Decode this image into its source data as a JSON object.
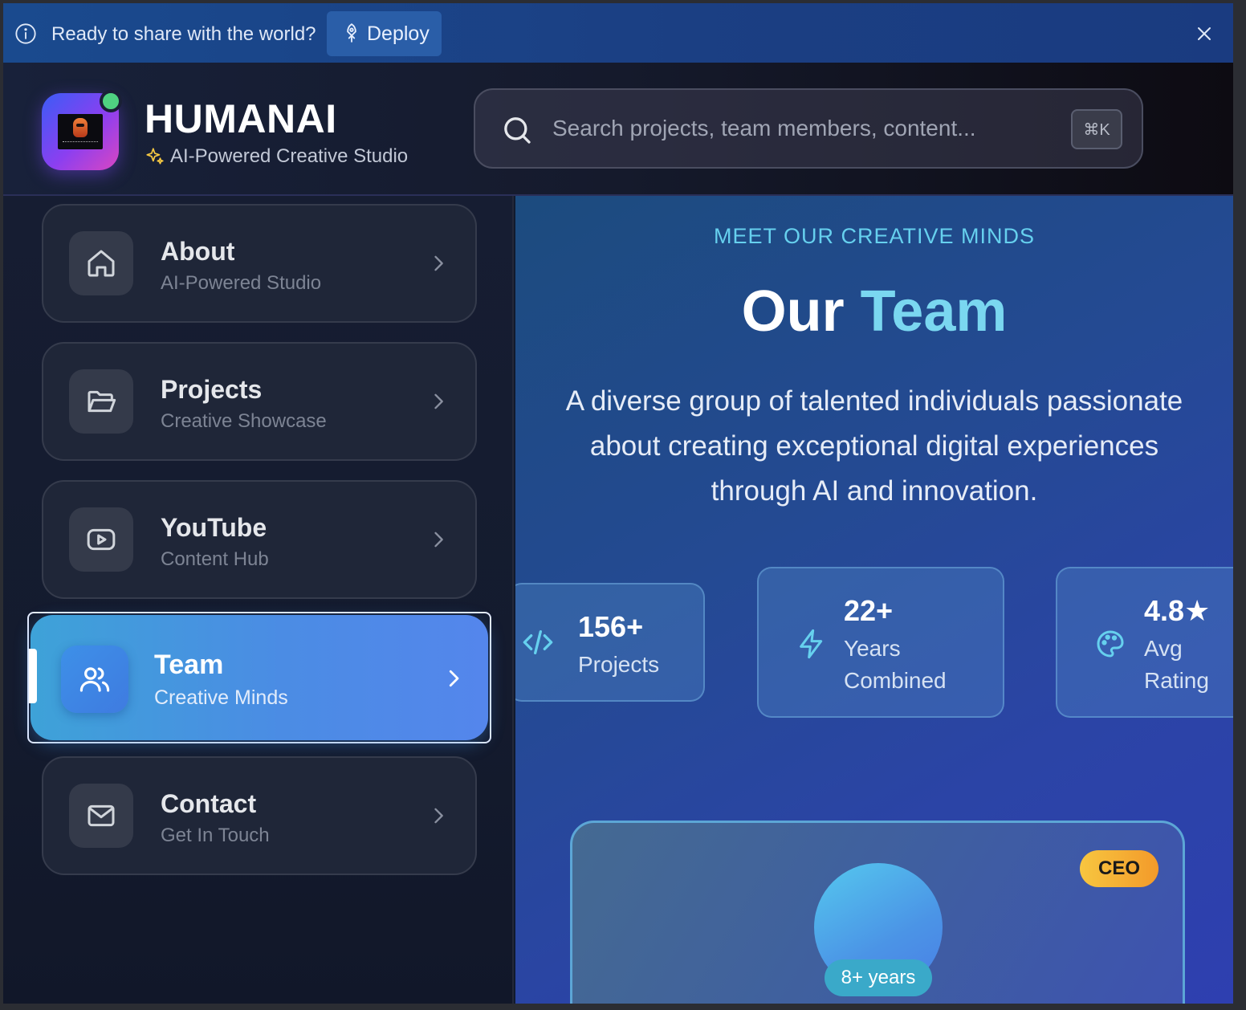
{
  "banner": {
    "message": "Ready to share with the world?",
    "deploy_label": "Deploy",
    "icons": {
      "info": "info-icon",
      "deploy": "rocket-icon",
      "close": "close-icon"
    }
  },
  "header": {
    "brand": "HUMANAI",
    "tagline": "AI-Powered Creative Studio",
    "logo_text": "HUMANAI",
    "status_color": "#4fd281"
  },
  "search": {
    "placeholder": "Search projects, team members, content...",
    "value": "",
    "shortcut": "⌘K"
  },
  "sidebar": {
    "items": [
      {
        "title": "About",
        "subtitle": "AI-Powered Studio",
        "icon": "home-icon",
        "active": false
      },
      {
        "title": "Projects",
        "subtitle": "Creative Showcase",
        "icon": "folder-open-icon",
        "active": false
      },
      {
        "title": "YouTube",
        "subtitle": "Content Hub",
        "icon": "youtube-icon",
        "active": false
      },
      {
        "title": "Team",
        "subtitle": "Creative Minds",
        "icon": "users-icon",
        "active": true
      },
      {
        "title": "Contact",
        "subtitle": "Get In Touch",
        "icon": "mail-icon",
        "active": false
      }
    ]
  },
  "main": {
    "eyebrow": "MEET OUR CREATIVE MINDS",
    "heading_part1": "Our",
    "heading_part2": "Team",
    "description": "A diverse group of talented individuals passionate about creating exceptional digital experiences through AI and innovation.",
    "stats": [
      {
        "value": "156+",
        "label": "Projects",
        "icon": "code-icon"
      },
      {
        "value": "22+",
        "label_line1": "Years",
        "label_line2": "Combined",
        "icon": "zap-icon"
      },
      {
        "value": "4.8★",
        "label_line1": "Avg",
        "label_line2": "Rating",
        "icon": "palette-icon"
      }
    ],
    "member_card": {
      "role_badge": "CEO",
      "experience": "8+ years"
    }
  },
  "colors": {
    "accent_cyan": "#7ad7f0",
    "active_nav": "#4b8ce4",
    "badge": "#f7c640"
  }
}
